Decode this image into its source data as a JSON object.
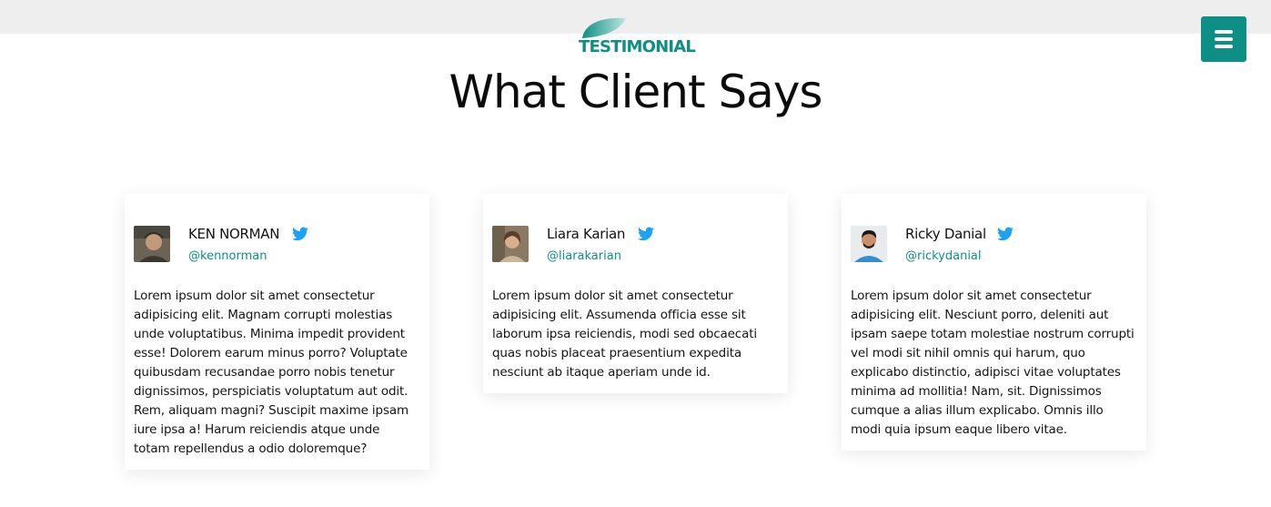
{
  "header": {
    "badge": "TESTIMONIAL",
    "heading": "What Client Says",
    "menu_icon": "hamburger-icon"
  },
  "colors": {
    "accent": "#0e8f85",
    "topbar": "#eeeeee",
    "twitter": "#1da1f2"
  },
  "testimonials": [
    {
      "name": "KEN NORMAN",
      "handle": "@kennorman",
      "icon": "twitter-icon",
      "text": "Lorem ipsum dolor sit amet consectetur adipisicing elit. Magnam corrupti molestias unde voluptatibus. Minima impedit provident esse! Dolorem earum minus porro? Voluptate quibusdam recusandae porro nobis tenetur dignissimos, perspiciatis voluptatum aut odit. Rem, aliquam magni? Suscipit maxime ipsam iure ipsa a! Harum reiciendis atque unde totam repellendus a odio doloremque?"
    },
    {
      "name": "Liara Karian",
      "handle": "@liarakarian",
      "icon": "twitter-icon",
      "text": "Lorem ipsum dolor sit amet consectetur adipisicing elit. Assumenda officia esse sit laborum ipsa reiciendis, modi sed obcaecati quas nobis placeat praesentium expedita nesciunt ab itaque aperiam unde id."
    },
    {
      "name": "Ricky Danial",
      "handle": "@rickydanial",
      "icon": "twitter-icon",
      "text": "Lorem ipsum dolor sit amet consectetur adipisicing elit. Nesciunt porro, deleniti aut ipsam saepe totam molestiae nostrum corrupti vel modi sit nihil omnis qui harum, quo explicabo distinctio, adipisci vitae voluptates minima ad mollitia! Nam, sit. Dignissimos cumque a alias illum explicabo. Omnis illo modi quia ipsum eaque libero vitae."
    }
  ]
}
